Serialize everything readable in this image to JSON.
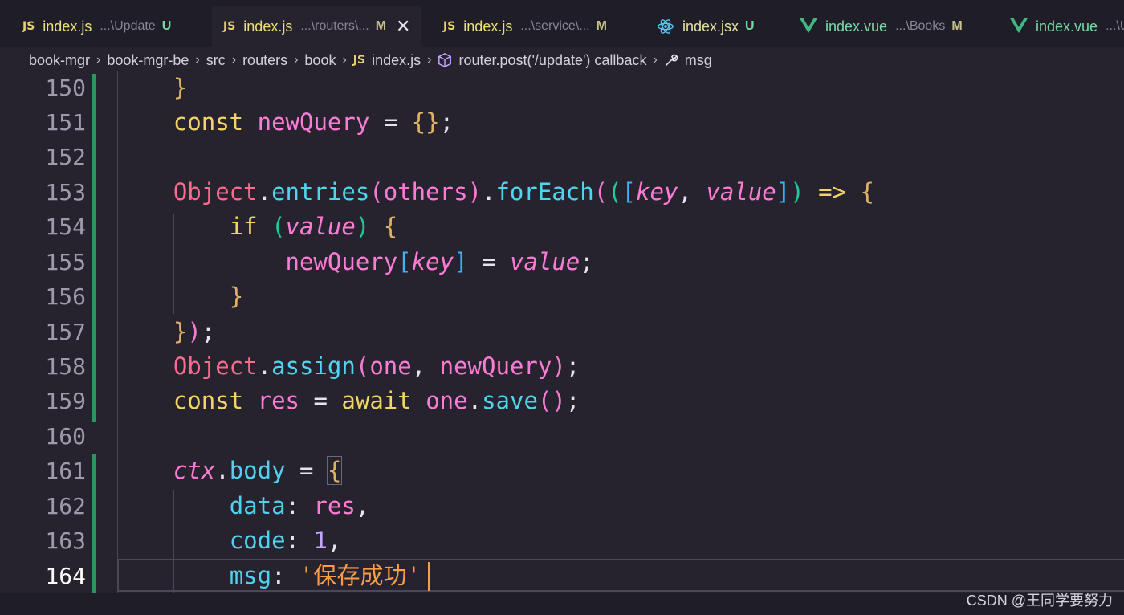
{
  "tabs": [
    {
      "icon": "js-file-icon",
      "name": "index.js",
      "path": "...\\Update",
      "status": "U",
      "active": false,
      "type": "js"
    },
    {
      "icon": "js-file-icon",
      "name": "index.js",
      "path": "...\\routers\\...",
      "status": "M",
      "active": true,
      "type": "js"
    },
    {
      "icon": "js-file-icon",
      "name": "index.js",
      "path": "...\\service\\...",
      "status": "M",
      "active": false,
      "type": "js"
    },
    {
      "icon": "react-file-icon",
      "name": "index.jsx",
      "path": "",
      "status": "U",
      "active": false,
      "type": "jsx"
    },
    {
      "icon": "vue-file-icon",
      "name": "index.vue",
      "path": "...\\Books",
      "status": "M",
      "active": false,
      "type": "vue"
    },
    {
      "icon": "vue-file-icon",
      "name": "index.vue",
      "path": "...\\U",
      "status": "",
      "active": false,
      "type": "vue"
    }
  ],
  "js_badge": "JS",
  "close_glyph": "✕",
  "breadcrumbs": {
    "items": [
      "book-mgr",
      "book-mgr-be",
      "src",
      "routers",
      "book",
      "index.js",
      "router.post('/update') callback",
      "msg"
    ],
    "separator": "›"
  },
  "editor": {
    "current_line": "164",
    "line_numbers": [
      "150",
      "151",
      "152",
      "153",
      "154",
      "155",
      "156",
      "157",
      "158",
      "159",
      "160",
      "161",
      "162",
      "163",
      "164"
    ]
  },
  "watermark": "CSDN @王同学要努力",
  "colors": {
    "background": "#26232f",
    "keyword": "#f3d565",
    "function": "#4dd6ee",
    "string": "#ff9d45",
    "modified_gutter": "#2f9360"
  }
}
